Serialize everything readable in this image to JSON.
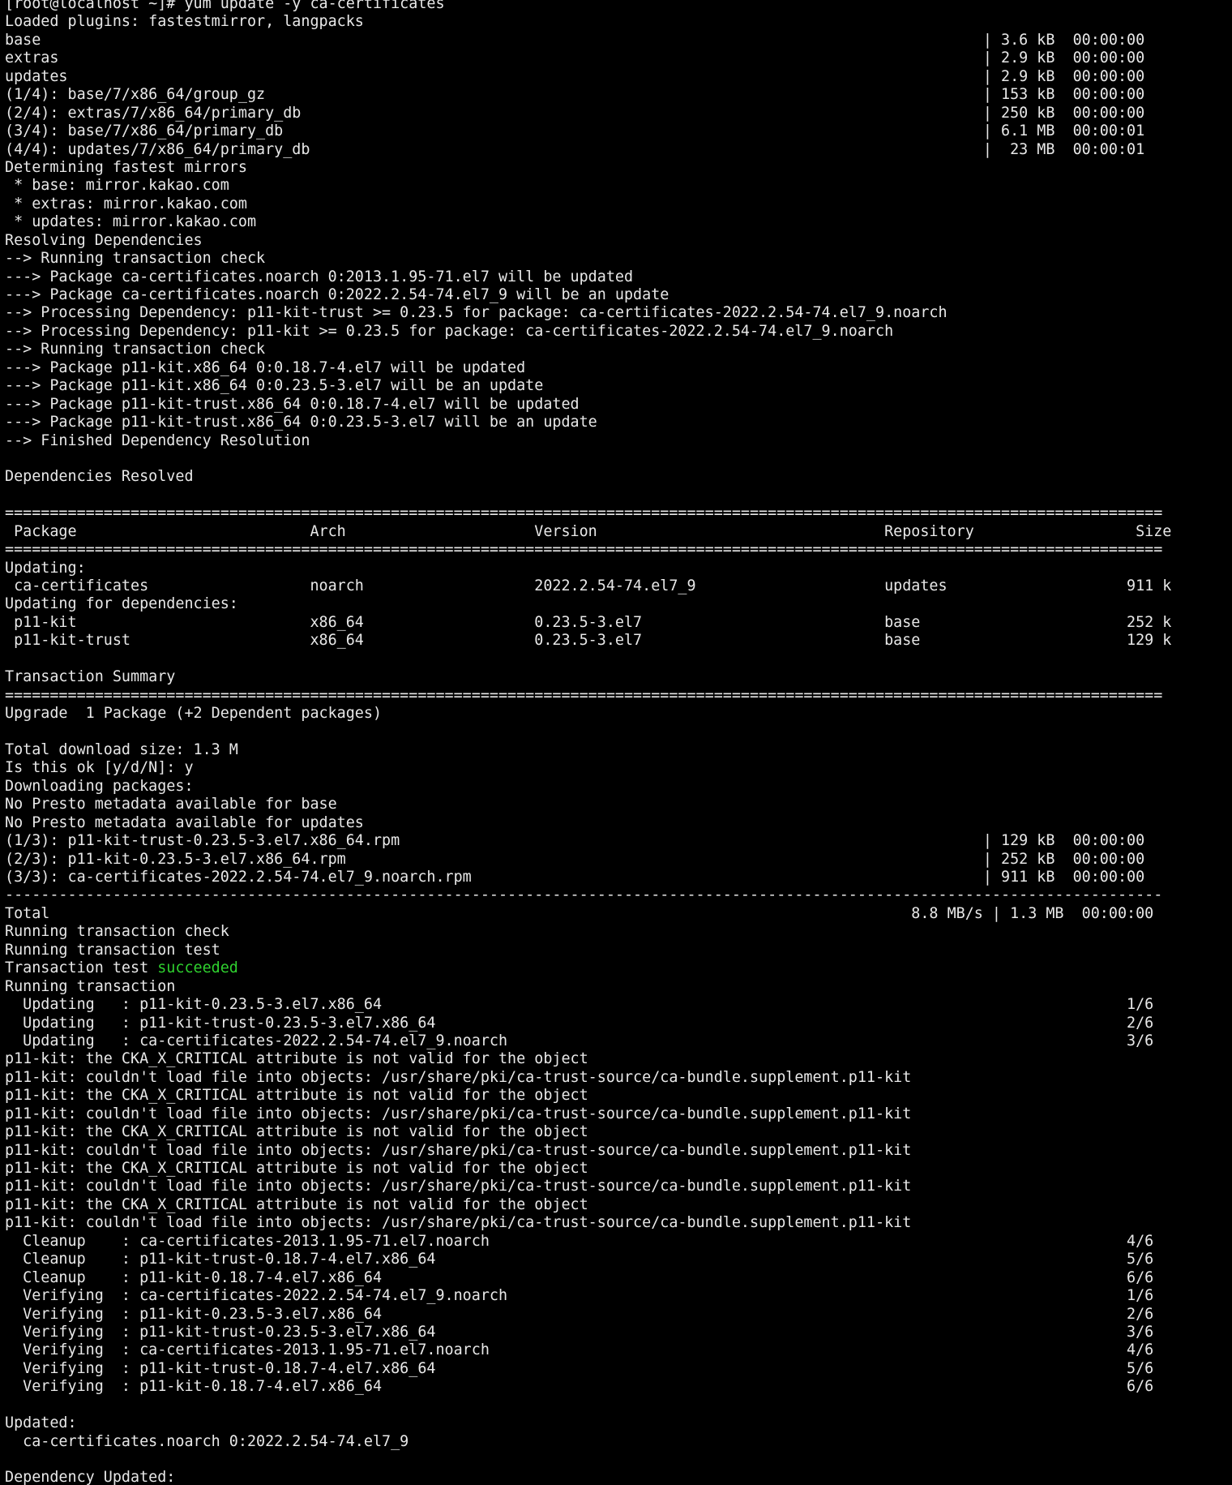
{
  "terminal": {
    "colors": {
      "background": "#000000",
      "foreground": "#e8e8e8",
      "success": "#2fd12f"
    },
    "lines": [
      {
        "text": "[root@localhost ~]# yum update -y ca-certificates"
      },
      {
        "text": "Loaded plugins: fastestmirror, langpacks"
      },
      {
        "text": "base                                                                                                         | 3.6 kB  00:00:00"
      },
      {
        "text": "extras                                                                                                       | 2.9 kB  00:00:00"
      },
      {
        "text": "updates                                                                                                      | 2.9 kB  00:00:00"
      },
      {
        "text": "(1/4): base/7/x86_64/group_gz                                                                                | 153 kB  00:00:00"
      },
      {
        "text": "(2/4): extras/7/x86_64/primary_db                                                                            | 250 kB  00:00:00"
      },
      {
        "text": "(3/4): base/7/x86_64/primary_db                                                                              | 6.1 MB  00:00:01"
      },
      {
        "text": "(4/4): updates/7/x86_64/primary_db                                                                           |  23 MB  00:00:01"
      },
      {
        "text": "Determining fastest mirrors"
      },
      {
        "text": " * base: mirror.kakao.com"
      },
      {
        "text": " * extras: mirror.kakao.com"
      },
      {
        "text": " * updates: mirror.kakao.com"
      },
      {
        "text": "Resolving Dependencies"
      },
      {
        "text": "--> Running transaction check"
      },
      {
        "text": "---> Package ca-certificates.noarch 0:2013.1.95-71.el7 will be updated"
      },
      {
        "text": "---> Package ca-certificates.noarch 0:2022.2.54-74.el7_9 will be an update"
      },
      {
        "text": "--> Processing Dependency: p11-kit-trust >= 0.23.5 for package: ca-certificates-2022.2.54-74.el7_9.noarch"
      },
      {
        "text": "--> Processing Dependency: p11-kit >= 0.23.5 for package: ca-certificates-2022.2.54-74.el7_9.noarch"
      },
      {
        "text": "--> Running transaction check"
      },
      {
        "text": "---> Package p11-kit.x86_64 0:0.18.7-4.el7 will be updated"
      },
      {
        "text": "---> Package p11-kit.x86_64 0:0.23.5-3.el7 will be an update"
      },
      {
        "text": "---> Package p11-kit-trust.x86_64 0:0.18.7-4.el7 will be updated"
      },
      {
        "text": "---> Package p11-kit-trust.x86_64 0:0.23.5-3.el7 will be an update"
      },
      {
        "text": "--> Finished Dependency Resolution"
      },
      {
        "text": ""
      },
      {
        "text": "Dependencies Resolved"
      },
      {
        "text": ""
      },
      {
        "text": "================================================================================================================================="
      },
      {
        "text": " Package                          Arch                     Version                                Repository                  Size"
      },
      {
        "text": "================================================================================================================================="
      },
      {
        "text": "Updating:"
      },
      {
        "text": " ca-certificates                  noarch                   2022.2.54-74.el7_9                     updates                    911 k"
      },
      {
        "text": "Updating for dependencies:"
      },
      {
        "text": " p11-kit                          x86_64                   0.23.5-3.el7                           base                       252 k"
      },
      {
        "text": " p11-kit-trust                    x86_64                   0.23.5-3.el7                           base                       129 k"
      },
      {
        "text": ""
      },
      {
        "text": "Transaction Summary"
      },
      {
        "text": "================================================================================================================================="
      },
      {
        "text": "Upgrade  1 Package (+2 Dependent packages)"
      },
      {
        "text": ""
      },
      {
        "text": "Total download size: 1.3 M"
      },
      {
        "text": "Is this ok [y/d/N]: y"
      },
      {
        "text": "Downloading packages:"
      },
      {
        "text": "No Presto metadata available for base"
      },
      {
        "text": "No Presto metadata available for updates"
      },
      {
        "text": "(1/3): p11-kit-trust-0.23.5-3.el7.x86_64.rpm                                                                 | 129 kB  00:00:00"
      },
      {
        "text": "(2/3): p11-kit-0.23.5-3.el7.x86_64.rpm                                                                       | 252 kB  00:00:00"
      },
      {
        "text": "(3/3): ca-certificates-2022.2.54-74.el7_9.noarch.rpm                                                         | 911 kB  00:00:00"
      },
      {
        "text": "---------------------------------------------------------------------------------------------------------------------------------"
      },
      {
        "text": "Total                                                                                                8.8 MB/s | 1.3 MB  00:00:00"
      },
      {
        "text": "Running transaction check"
      },
      {
        "text": "Running transaction test"
      },
      {
        "text": "Transaction test ",
        "highlight": "succeeded"
      },
      {
        "text": "Running transaction"
      },
      {
        "text": "  Updating   : p11-kit-0.23.5-3.el7.x86_64                                                                                   1/6"
      },
      {
        "text": "  Updating   : p11-kit-trust-0.23.5-3.el7.x86_64                                                                             2/6"
      },
      {
        "text": "  Updating   : ca-certificates-2022.2.54-74.el7_9.noarch                                                                     3/6"
      },
      {
        "text": "p11-kit: the CKA_X_CRITICAL attribute is not valid for the object"
      },
      {
        "text": "p11-kit: couldn't load file into objects: /usr/share/pki/ca-trust-source/ca-bundle.supplement.p11-kit"
      },
      {
        "text": "p11-kit: the CKA_X_CRITICAL attribute is not valid for the object"
      },
      {
        "text": "p11-kit: couldn't load file into objects: /usr/share/pki/ca-trust-source/ca-bundle.supplement.p11-kit"
      },
      {
        "text": "p11-kit: the CKA_X_CRITICAL attribute is not valid for the object"
      },
      {
        "text": "p11-kit: couldn't load file into objects: /usr/share/pki/ca-trust-source/ca-bundle.supplement.p11-kit"
      },
      {
        "text": "p11-kit: the CKA_X_CRITICAL attribute is not valid for the object"
      },
      {
        "text": "p11-kit: couldn't load file into objects: /usr/share/pki/ca-trust-source/ca-bundle.supplement.p11-kit"
      },
      {
        "text": "p11-kit: the CKA_X_CRITICAL attribute is not valid for the object"
      },
      {
        "text": "p11-kit: couldn't load file into objects: /usr/share/pki/ca-trust-source/ca-bundle.supplement.p11-kit"
      },
      {
        "text": "  Cleanup    : ca-certificates-2013.1.95-71.el7.noarch                                                                       4/6"
      },
      {
        "text": "  Cleanup    : p11-kit-trust-0.18.7-4.el7.x86_64                                                                             5/6"
      },
      {
        "text": "  Cleanup    : p11-kit-0.18.7-4.el7.x86_64                                                                                   6/6"
      },
      {
        "text": "  Verifying  : ca-certificates-2022.2.54-74.el7_9.noarch                                                                     1/6"
      },
      {
        "text": "  Verifying  : p11-kit-0.23.5-3.el7.x86_64                                                                                   2/6"
      },
      {
        "text": "  Verifying  : p11-kit-trust-0.23.5-3.el7.x86_64                                                                             3/6"
      },
      {
        "text": "  Verifying  : ca-certificates-2013.1.95-71.el7.noarch                                                                       4/6"
      },
      {
        "text": "  Verifying  : p11-kit-trust-0.18.7-4.el7.x86_64                                                                             5/6"
      },
      {
        "text": "  Verifying  : p11-kit-0.18.7-4.el7.x86_64                                                                                   6/6"
      },
      {
        "text": ""
      },
      {
        "text": "Updated:"
      },
      {
        "text": "  ca-certificates.noarch 0:2022.2.54-74.el7_9"
      },
      {
        "text": ""
      },
      {
        "text": "Dependency Updated:"
      }
    ]
  }
}
